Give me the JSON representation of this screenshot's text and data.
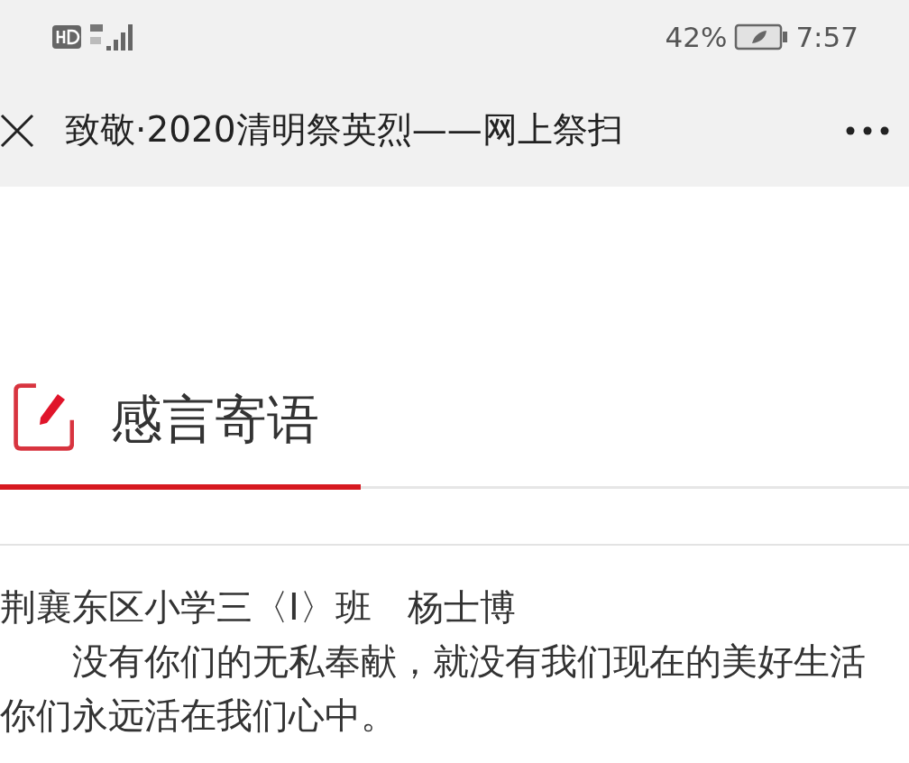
{
  "status_bar": {
    "battery": "42%",
    "time": "7:57"
  },
  "title_bar": {
    "title": "致敬·2020清明祭英烈——网上祭扫"
  },
  "section": {
    "title": "感言寄语"
  },
  "message": {
    "author": "荆襄东区小学三〈I〉班　杨士博",
    "lines": [
      "没有你们的无私奉献，就没有我们现在的美好生活",
      "你们永远活在我们心中。"
    ]
  }
}
